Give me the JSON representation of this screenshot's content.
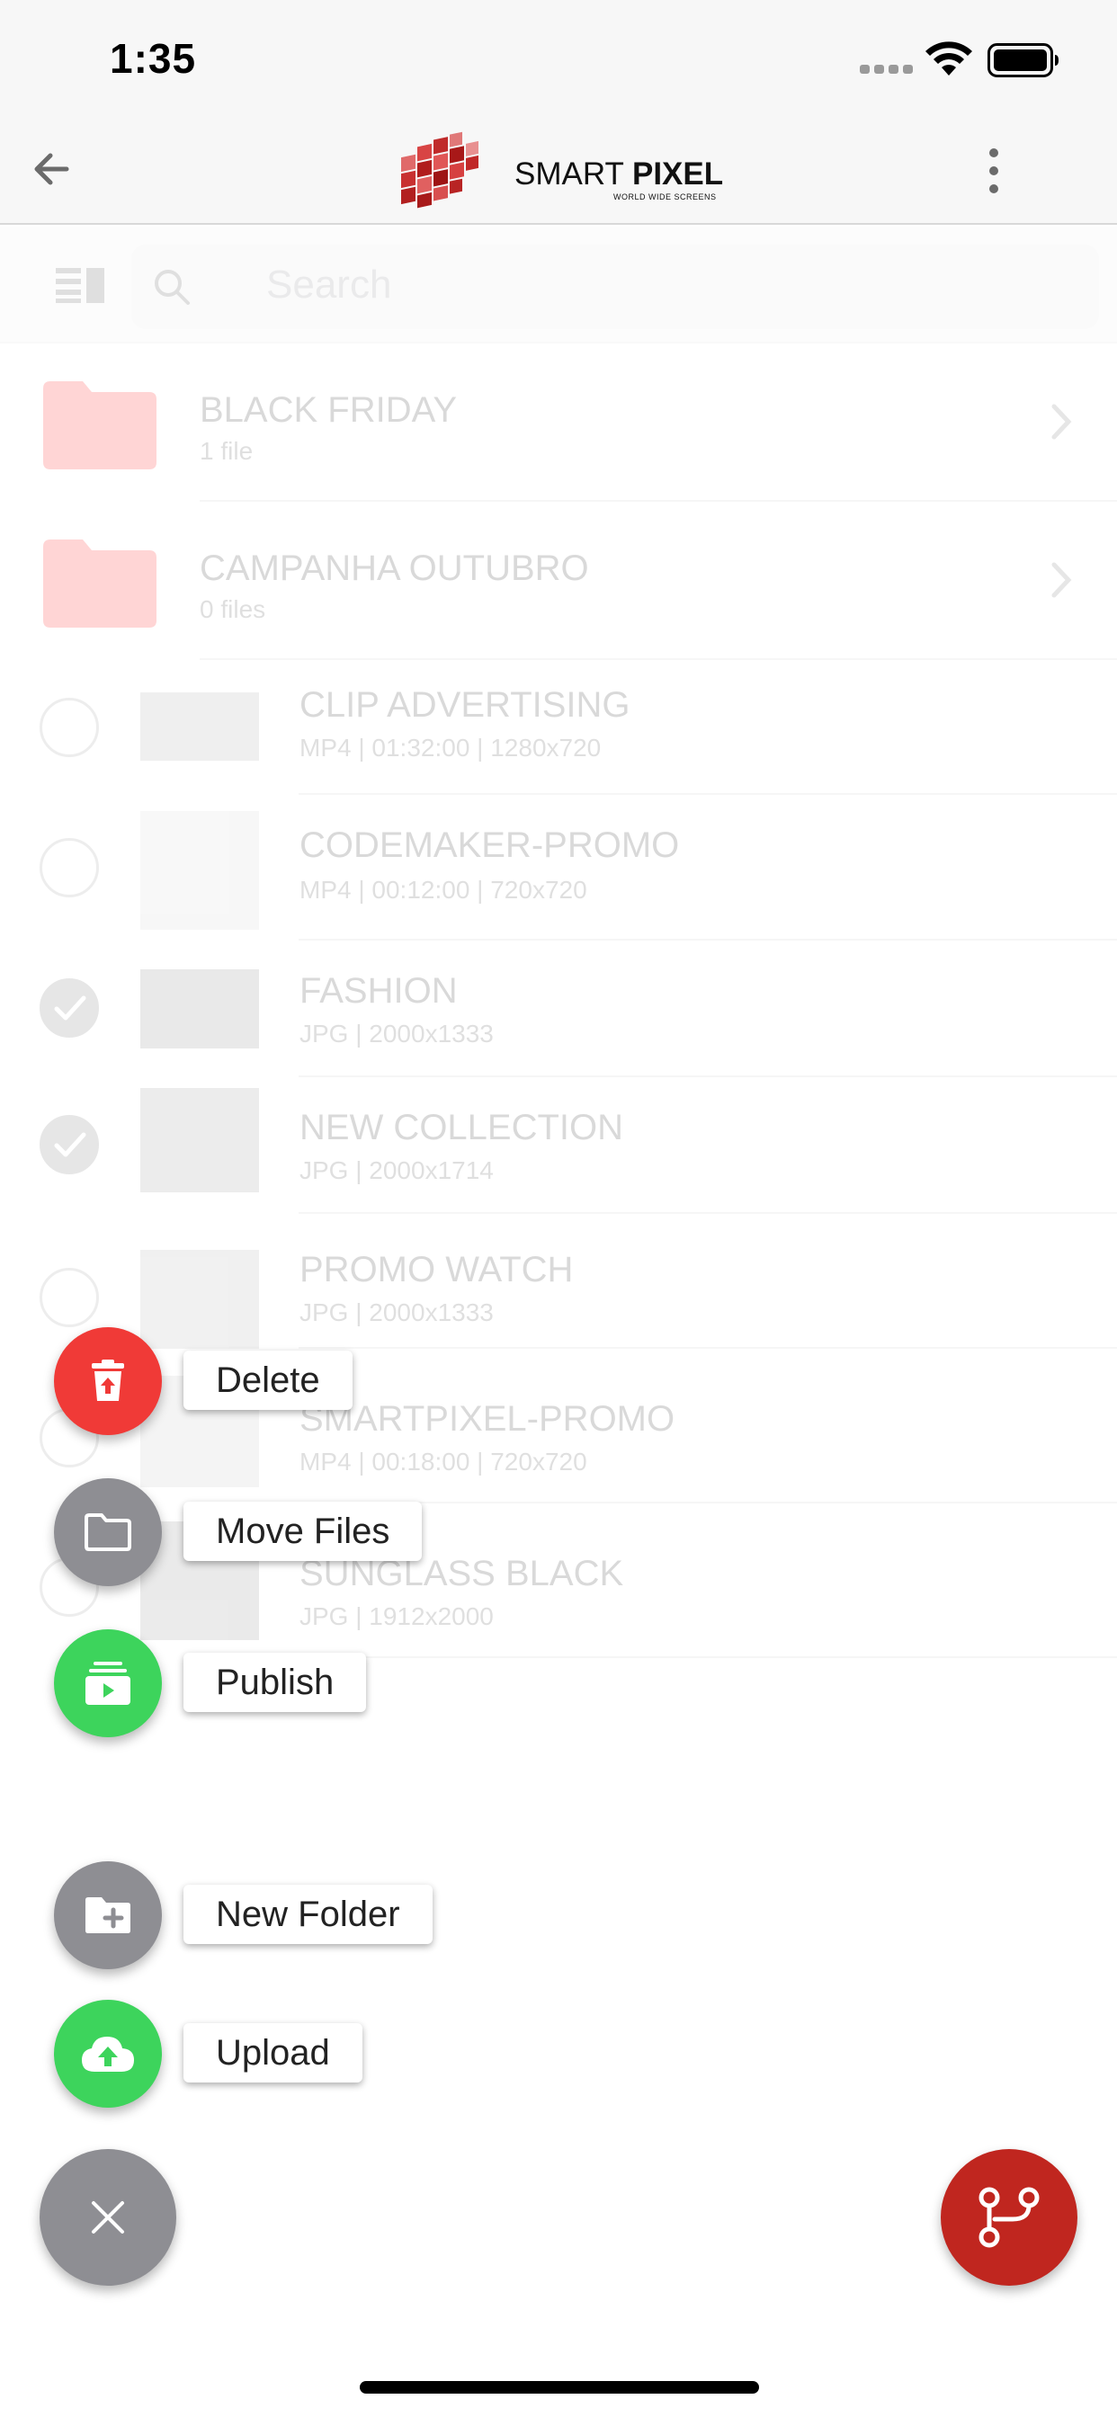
{
  "status_bar": {
    "time": "1:35"
  },
  "header": {
    "brand_name_1": "SMART ",
    "brand_name_2": "PIXEL",
    "brand_tagline": "WORLD WIDE SCREENS"
  },
  "search": {
    "placeholder": "Search"
  },
  "folders": [
    {
      "name": "BLACK FRIDAY",
      "count": "1 file"
    },
    {
      "name": "CAMPANHA OUTUBRO",
      "count": "0 files"
    }
  ],
  "files": [
    {
      "name": "CLIP ADVERTISING",
      "meta": "MP4 | 01:32:00 | 1280x720",
      "checked": false
    },
    {
      "name": "CODEMAKER-PROMO",
      "meta": "MP4 | 00:12:00 | 720x720",
      "checked": false
    },
    {
      "name": "FASHION",
      "meta": "JPG | 2000x1333",
      "checked": true
    },
    {
      "name": "NEW COLLECTION",
      "meta": "JPG | 2000x1714",
      "checked": true
    },
    {
      "name": "PROMO WATCH",
      "meta": "JPG | 2000x1333",
      "checked": false
    },
    {
      "name": "SMARTPIXEL-PROMO",
      "meta": "MP4 | 00:18:00 | 720x720",
      "checked": false
    },
    {
      "name": "SUNGLASS BLACK",
      "meta": "JPG | 1912x2000",
      "checked": false
    }
  ],
  "speed_dial": {
    "delete_label": "Delete",
    "move_label": "Move Files",
    "publish_label": "Publish",
    "new_folder_label": "New Folder",
    "upload_label": "Upload"
  },
  "colors": {
    "danger": "#f03a37",
    "neutral": "#8e8e93",
    "success": "#3dd45c",
    "brand": "#c0261f"
  }
}
